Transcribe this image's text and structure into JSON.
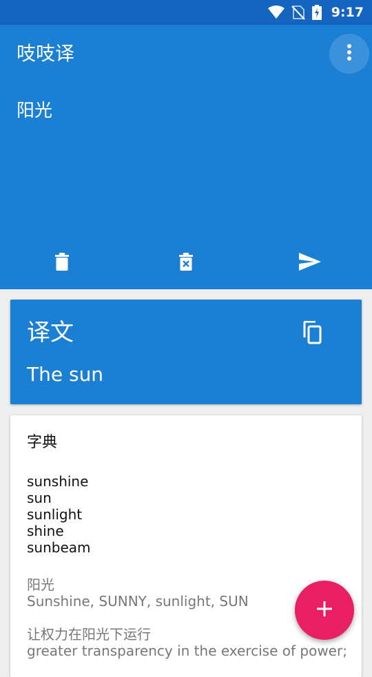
{
  "status_bar": {
    "time": "9:17",
    "icons": [
      "wifi-icon",
      "no-sim-icon",
      "battery-charging-icon"
    ]
  },
  "app": {
    "title": "吱吱译",
    "menu_icon": "more-vert-icon",
    "input_text": "阳光",
    "actions": [
      {
        "name": "delete-button",
        "icon": "trash-icon"
      },
      {
        "name": "clear-button",
        "icon": "trash-x-icon"
      },
      {
        "name": "send-button",
        "icon": "send-icon"
      }
    ]
  },
  "translation": {
    "title": "译文",
    "result": "The sun",
    "copy_icon": "copy-icon"
  },
  "dictionary": {
    "title": "字典",
    "words": [
      "sunshine",
      "sun",
      "sunlight",
      "shine",
      "sunbeam"
    ],
    "phrases": [
      {
        "cn": "阳光",
        "en": "Sunshine, SUNNY, sunlight, SUN"
      },
      {
        "cn": "让权力在阳光下运行",
        "en": "greater transparency in the exercise of power;"
      }
    ]
  },
  "fab": {
    "icon": "plus-icon"
  },
  "colors": {
    "primary": "#1b7fd4",
    "primary_dark": "#1565c0",
    "accent": "#ea1e63",
    "background": "#eeeeee"
  }
}
